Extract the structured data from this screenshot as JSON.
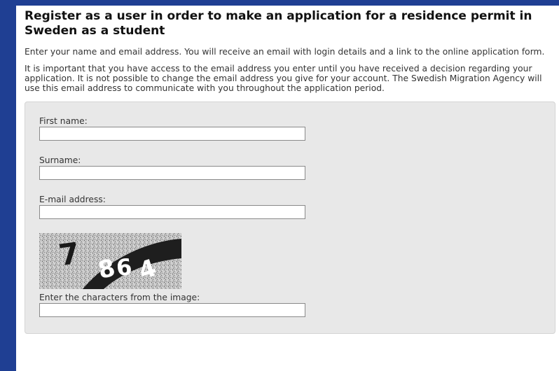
{
  "page": {
    "title": "Register as a user in order to make an application for a residence permit in Sweden as a student",
    "intro": "Enter your name and email address. You will receive an email with login details and a link to the online application form.",
    "notice": "It is important that you have access to the email address you enter until you have received a decision regarding your application. It is not possible to change the email address you give for your account. The Swedish Migration Agency will use this email address to communicate with you throughout the application period."
  },
  "form": {
    "first_name_label": "First name:",
    "first_name_value": "",
    "surname_label": "Surname:",
    "surname_value": "",
    "email_label": "E-mail address:",
    "email_value": "",
    "captcha_label": "Enter the characters from the image:",
    "captcha_value": "",
    "captcha_image_text": "7864"
  },
  "colors": {
    "background": "#1f3f93",
    "panel": "#ffffff",
    "form_box": "#e8e8e8"
  }
}
